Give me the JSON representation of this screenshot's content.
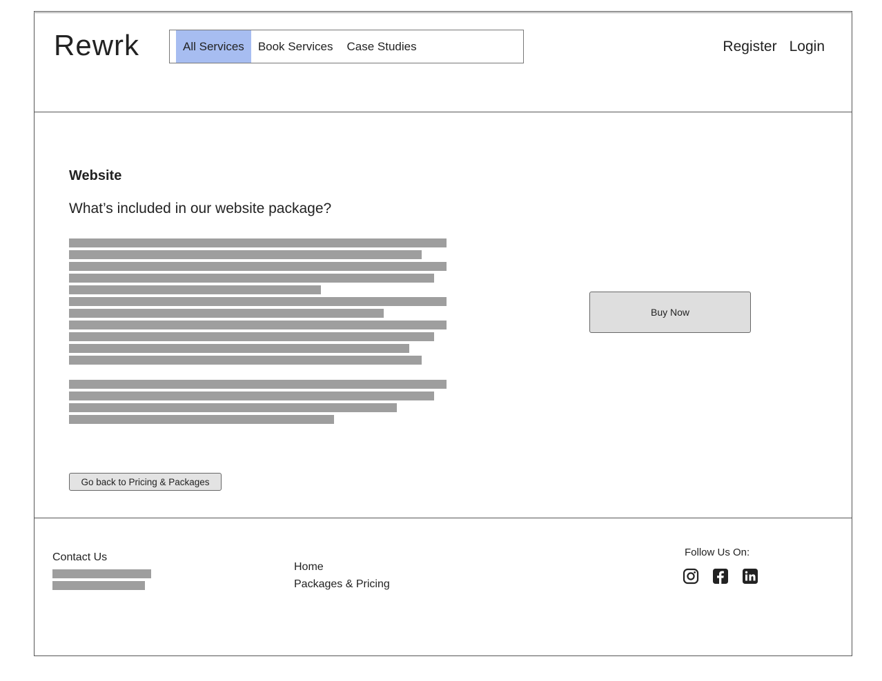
{
  "header": {
    "logo": "Rewrk",
    "nav": [
      {
        "label": "All Services",
        "active": true
      },
      {
        "label": "Book Services",
        "active": false
      },
      {
        "label": "Case Studies",
        "active": false
      }
    ],
    "register": "Register",
    "login": "Login",
    "active_color": "#a7bdf1"
  },
  "main": {
    "heading": "Website",
    "subheading": "What’s included in our website package?",
    "buy_button": "Buy Now",
    "back_button": "Go back to Pricing & Packages"
  },
  "footer": {
    "contact_title": "Contact Us",
    "links": [
      "Home",
      "Packages & Pricing"
    ],
    "follow_label": "Follow Us On:",
    "social_icons": [
      "instagram-icon",
      "facebook-icon",
      "linkedin-icon"
    ]
  }
}
